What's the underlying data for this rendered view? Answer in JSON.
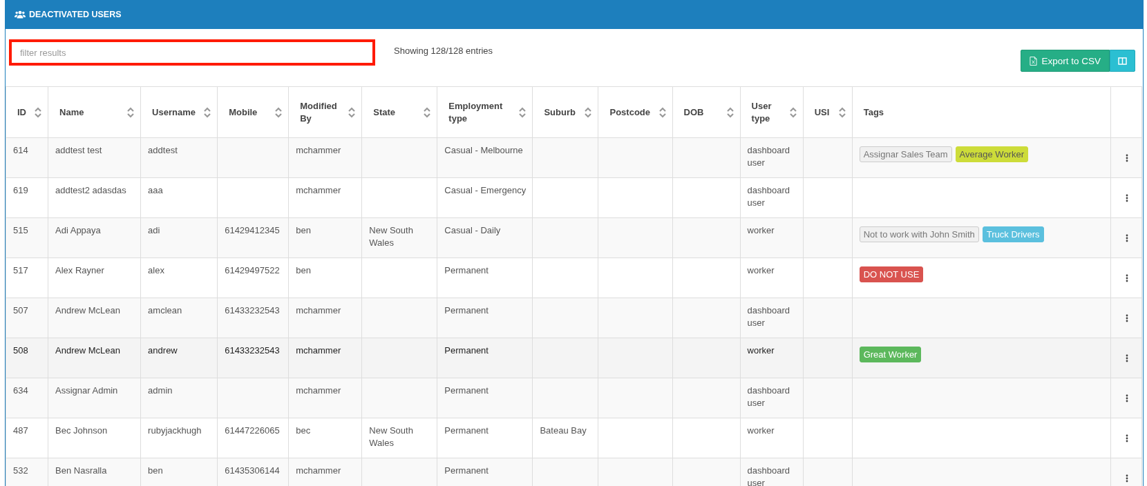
{
  "panel": {
    "title": "DEACTIVATED USERS"
  },
  "filter": {
    "placeholder": "filter results"
  },
  "entries_info": "Showing 128/128 entries",
  "buttons": {
    "export": "Export to CSV"
  },
  "table": {
    "columns": [
      {
        "label": "ID",
        "sortable": true
      },
      {
        "label": "Name",
        "sortable": true
      },
      {
        "label": "Username",
        "sortable": true
      },
      {
        "label": "Mobile",
        "sortable": true
      },
      {
        "label": "Modified By",
        "sortable": true
      },
      {
        "label": "State",
        "sortable": true
      },
      {
        "label": "Employment type",
        "sortable": true
      },
      {
        "label": "Suburb",
        "sortable": true
      },
      {
        "label": "Postcode",
        "sortable": true
      },
      {
        "label": "DOB",
        "sortable": true
      },
      {
        "label": "User type",
        "sortable": true
      },
      {
        "label": "USI",
        "sortable": true
      },
      {
        "label": "Tags",
        "sortable": false
      }
    ],
    "rows": [
      {
        "cells": [
          "614",
          "addtest test",
          "addtest",
          "",
          "mchammer",
          "",
          "Casual - Melbourne",
          "",
          "",
          "",
          "dashboard user",
          ""
        ],
        "tags": [
          {
            "label": "Assignar Sales Team",
            "color": "#f0f0f0"
          },
          {
            "label": "Average Worker",
            "color": "#cddc39"
          }
        ],
        "highlighted": false
      },
      {
        "cells": [
          "619",
          "addtest2 adasdas",
          "aaa",
          "",
          "mchammer",
          "",
          "Casual - Emergency",
          "",
          "",
          "",
          "dashboard user",
          ""
        ],
        "tags": [],
        "highlighted": false
      },
      {
        "cells": [
          "515",
          "Adi Appaya",
          "adi",
          "61429412345",
          "ben",
          "New South Wales",
          "Casual - Daily",
          "",
          "",
          "",
          "worker",
          ""
        ],
        "tags": [
          {
            "label": "Not to work with John Smith",
            "color": "#f0f0f0"
          },
          {
            "label": "Truck Drivers",
            "color": "#5bc0de"
          }
        ],
        "highlighted": false
      },
      {
        "cells": [
          "517",
          "Alex Rayner",
          "alex",
          "61429497522",
          "ben",
          "",
          "Permanent",
          "",
          "",
          "",
          "worker",
          ""
        ],
        "tags": [
          {
            "label": "DO NOT USE",
            "color": "#d9534f"
          }
        ],
        "highlighted": false
      },
      {
        "cells": [
          "507",
          "Andrew McLean",
          "amclean",
          "61433232543",
          "mchammer",
          "",
          "Permanent",
          "",
          "",
          "",
          "dashboard user",
          ""
        ],
        "tags": [],
        "highlighted": false
      },
      {
        "cells": [
          "508",
          "Andrew McLean",
          "andrew",
          "61433232543",
          "mchammer",
          "",
          "Permanent",
          "",
          "",
          "",
          "worker",
          ""
        ],
        "tags": [
          {
            "label": "Great Worker",
            "color": "#5cb85c"
          }
        ],
        "highlighted": true
      },
      {
        "cells": [
          "634",
          "Assignar Admin",
          "admin",
          "",
          "mchammer",
          "",
          "Permanent",
          "",
          "",
          "",
          "dashboard user",
          ""
        ],
        "tags": [],
        "highlighted": false
      },
      {
        "cells": [
          "487",
          "Bec Johnson",
          "rubyjackhugh",
          "61447226065",
          "bec",
          "New South Wales",
          "Permanent",
          "Bateau Bay",
          "",
          "",
          "worker",
          ""
        ],
        "tags": [],
        "highlighted": false
      },
      {
        "cells": [
          "532",
          "Ben Nasralla",
          "ben",
          "61435306144",
          "mchammer",
          "",
          "Permanent",
          "",
          "",
          "",
          "dashboard user",
          ""
        ],
        "tags": [],
        "highlighted": false
      }
    ]
  }
}
